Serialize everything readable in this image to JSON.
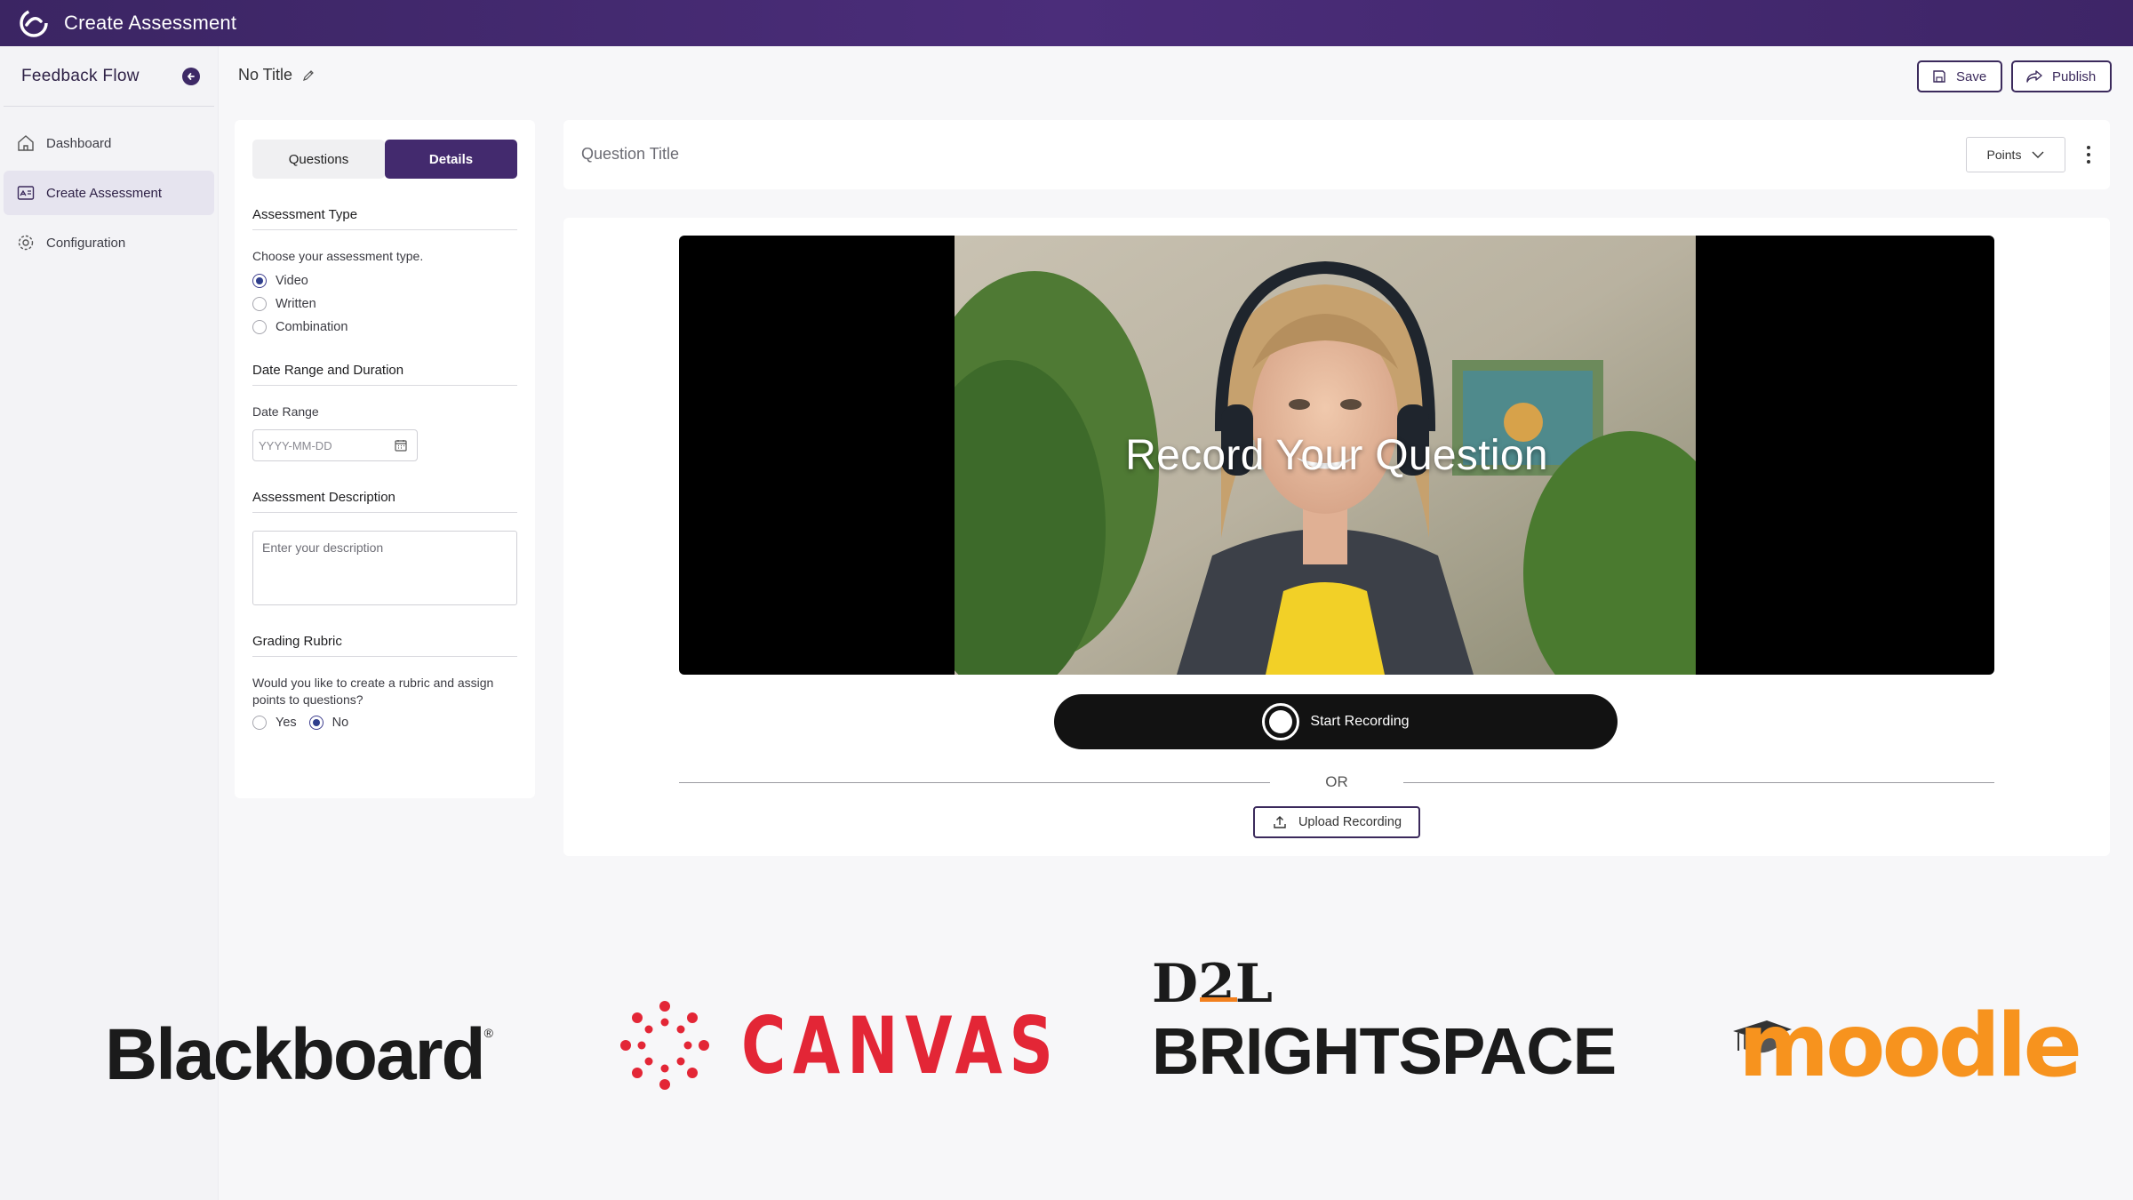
{
  "window": {
    "title": "Create Assessment"
  },
  "sidebar": {
    "brand": "Feedback Flow",
    "items": [
      {
        "label": "Dashboard",
        "icon": "home-icon",
        "active": false
      },
      {
        "label": "Create Assessment",
        "icon": "assessment-icon",
        "active": true
      },
      {
        "label": "Configuration",
        "icon": "gear-icon",
        "active": false
      }
    ]
  },
  "header": {
    "title": "No Title",
    "save_label": "Save",
    "publish_label": "Publish"
  },
  "left_panel": {
    "tabs": [
      {
        "label": "Questions",
        "active": false
      },
      {
        "label": "Details",
        "active": true
      }
    ],
    "assessment_type": {
      "title": "Assessment Type",
      "help": "Choose your assessment type.",
      "options": [
        "Video",
        "Written",
        "Combination"
      ],
      "selected": "Video"
    },
    "date_range": {
      "title": "Date Range and Duration",
      "label": "Date Range",
      "placeholder": "YYYY-MM-DD"
    },
    "description": {
      "title": "Assessment Description",
      "placeholder": "Enter your description"
    },
    "rubric": {
      "title": "Grading Rubric",
      "question": "Would you like to create a rubric and assign points to questions?",
      "options": [
        "Yes",
        "No"
      ],
      "selected": "No"
    }
  },
  "question": {
    "title_placeholder": "Question Title",
    "points_label": "Points"
  },
  "video": {
    "overlay_text": "Record Your Question",
    "record_label": "Start Recording",
    "or_text": "OR",
    "upload_label": "Upload Recording"
  },
  "logos": {
    "blackboard": "Blackboard",
    "canvas": "CANVAS",
    "d2l": "D2L",
    "brightspace": "BRIGHTSPACE",
    "moodle": "moodle"
  },
  "colors": {
    "brand_purple": "#432a6e",
    "canvas_red": "#e32636",
    "moodle_orange": "#f7931e",
    "d2l_orange": "#f2801e"
  }
}
